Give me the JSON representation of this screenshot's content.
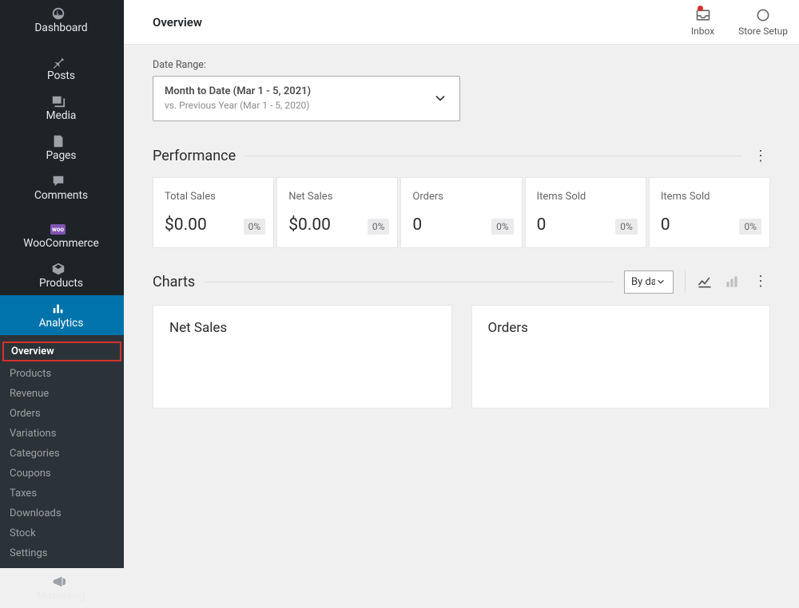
{
  "page_title": "Overview",
  "sidebar": {
    "dashboard": "Dashboard",
    "posts": "Posts",
    "media": "Media",
    "pages": "Pages",
    "comments": "Comments",
    "woocommerce": "WooCommerce",
    "products": "Products",
    "analytics": "Analytics",
    "marketing": "Marketing",
    "sub": {
      "overview": "Overview",
      "products": "Products",
      "revenue": "Revenue",
      "orders": "Orders",
      "variations": "Variations",
      "categories": "Categories",
      "coupons": "Coupons",
      "taxes": "Taxes",
      "downloads": "Downloads",
      "stock": "Stock",
      "settings": "Settings"
    }
  },
  "topbar": {
    "inbox": "Inbox",
    "store_setup": "Store Setup"
  },
  "daterange": {
    "label": "Date Range:",
    "selected": "Month to Date (Mar 1 - 5, 2021)",
    "compare": "vs. Previous Year (Mar 1 - 5, 2020)"
  },
  "performance": {
    "title": "Performance",
    "cards": [
      {
        "label": "Total Sales",
        "value": "$0.00",
        "delta": "0%"
      },
      {
        "label": "Net Sales",
        "value": "$0.00",
        "delta": "0%"
      },
      {
        "label": "Orders",
        "value": "0",
        "delta": "0%"
      },
      {
        "label": "Items Sold",
        "value": "0",
        "delta": "0%"
      },
      {
        "label": "Items Sold",
        "value": "0",
        "delta": "0%"
      }
    ]
  },
  "charts": {
    "title": "Charts",
    "interval": "By day",
    "panels": [
      {
        "title": "Net Sales"
      },
      {
        "title": "Orders"
      }
    ]
  }
}
